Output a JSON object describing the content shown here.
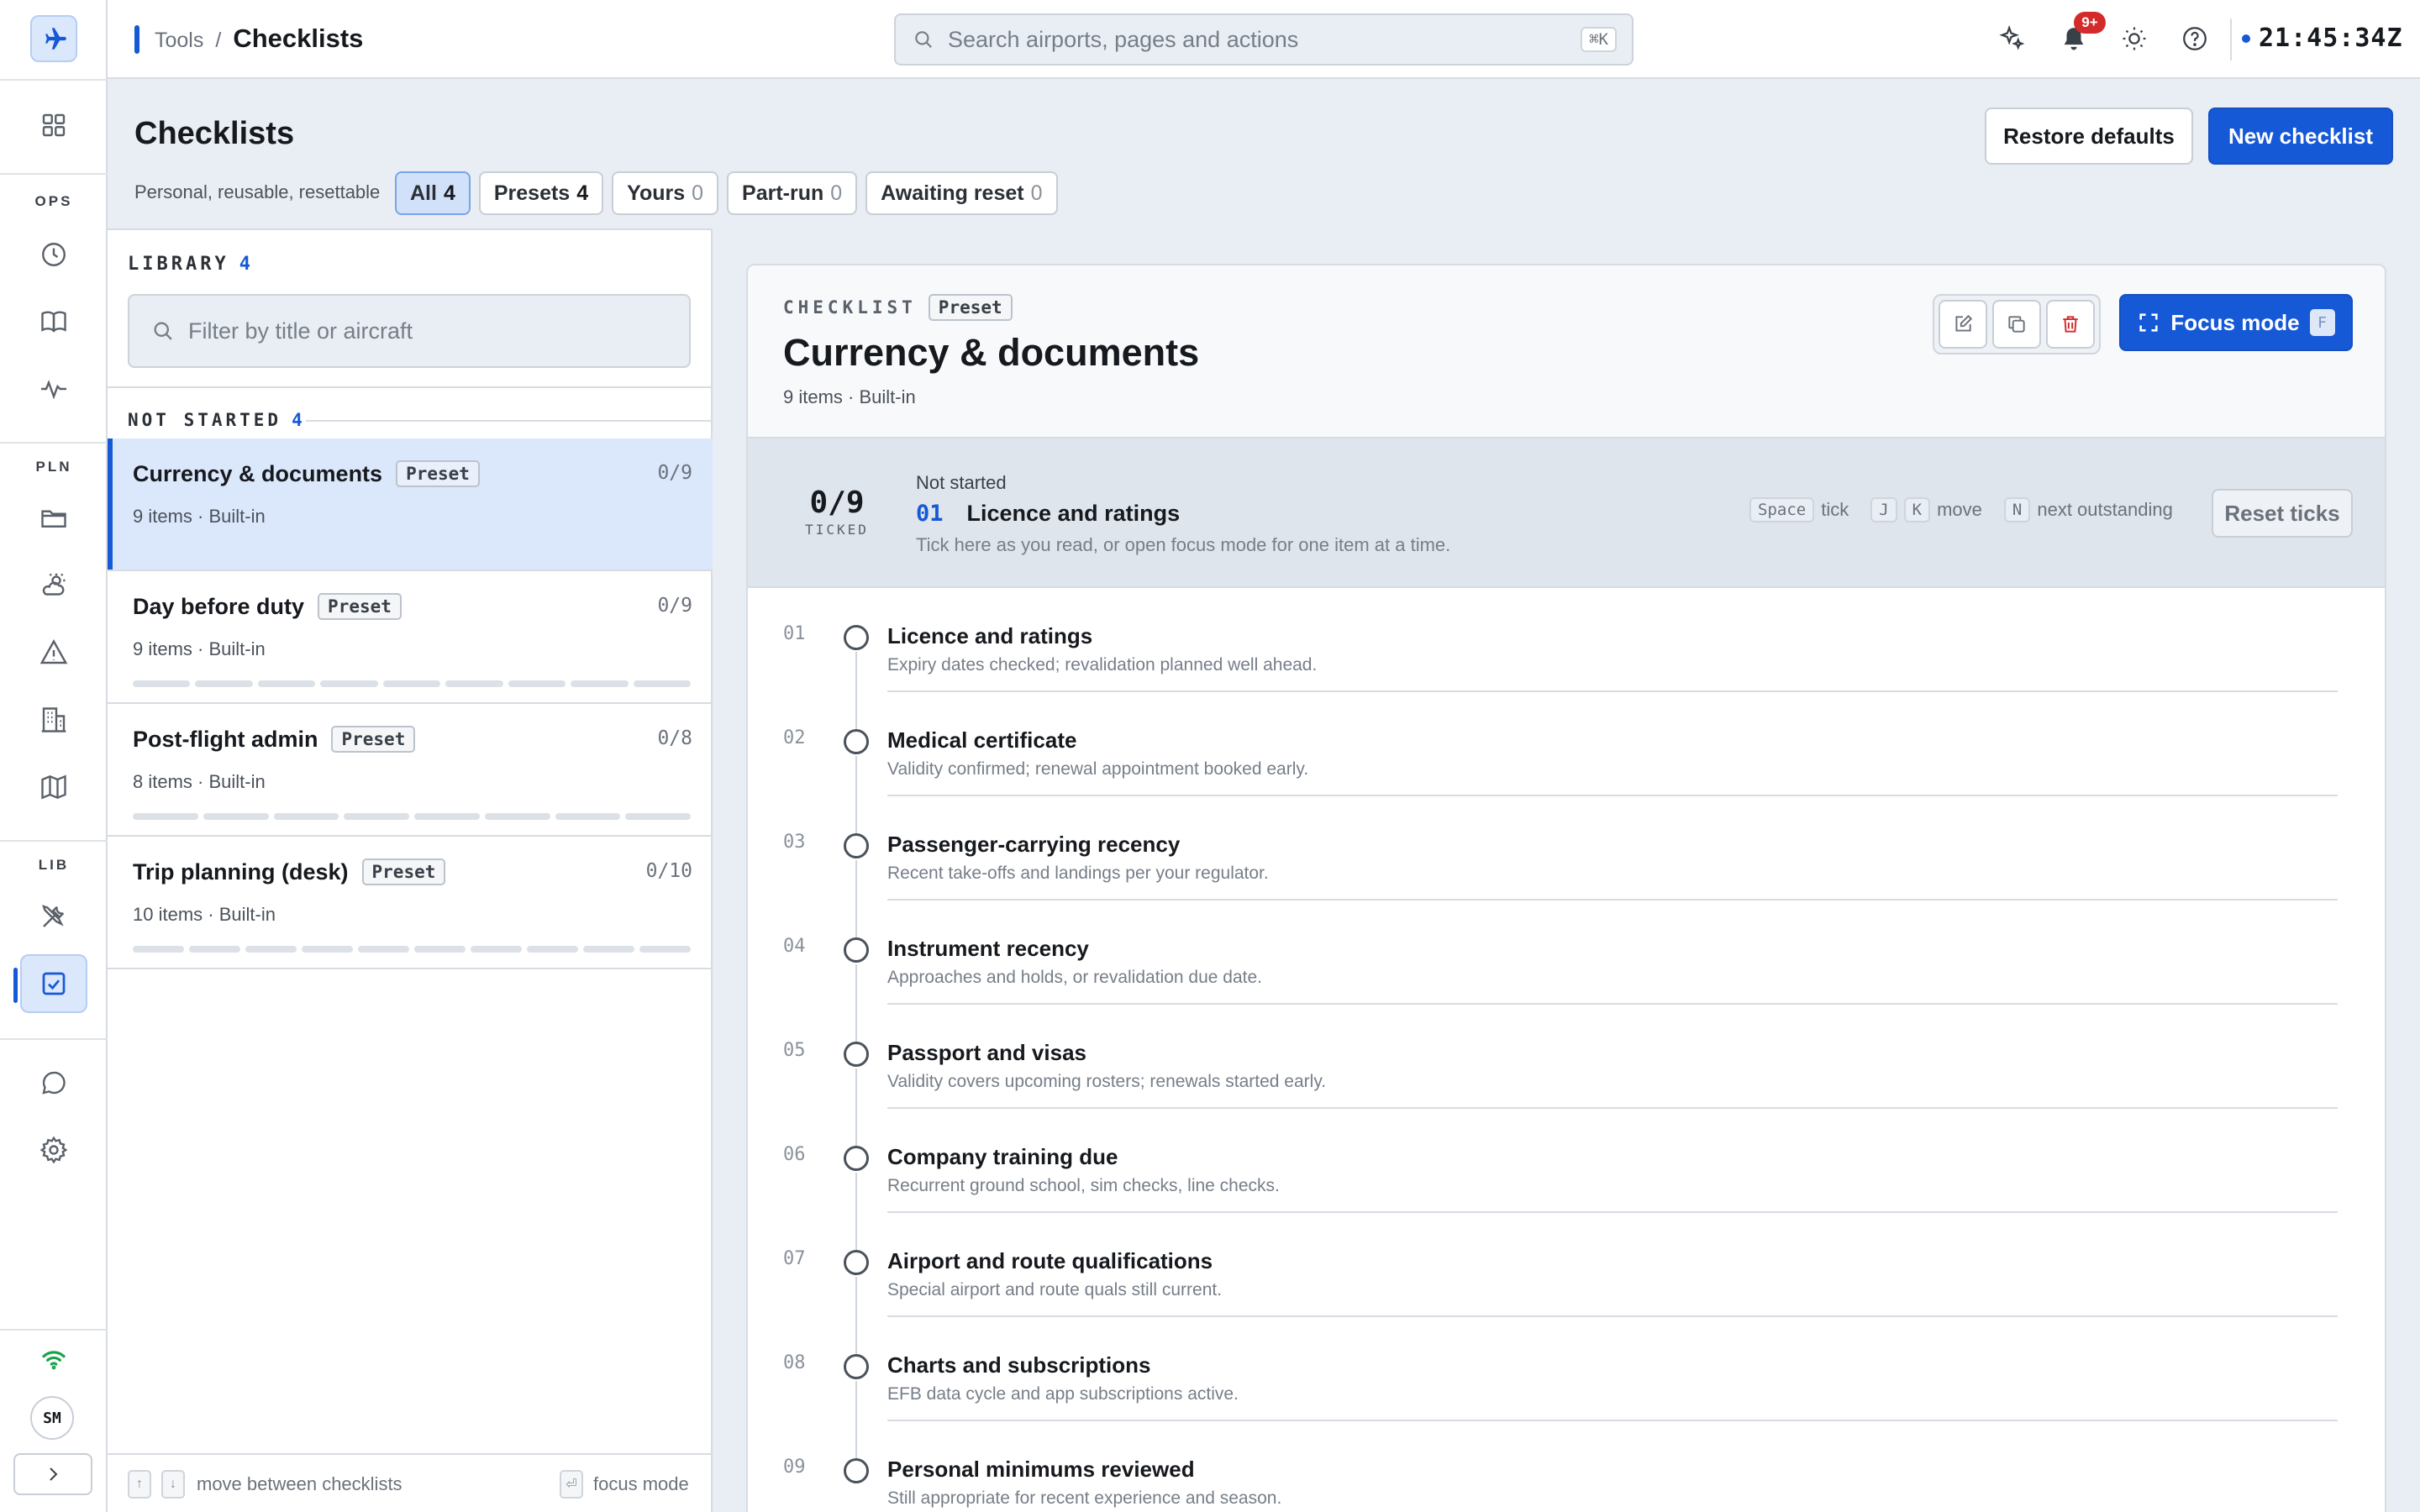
{
  "sidebar": {
    "sections": [
      "OPS",
      "PLN",
      "LIB"
    ],
    "user_initials": "SM"
  },
  "topbar": {
    "breadcrumb_parent": "Tools",
    "breadcrumb_sep": "/",
    "breadcrumb_current": "Checklists",
    "search_placeholder": "Search airports, pages and actions",
    "search_shortcut": "⌘K",
    "notification_badge": "9+",
    "clock": "21:45:34Z"
  },
  "page": {
    "title": "Checklists",
    "subtitle": "Personal, reusable, resettable",
    "tabs": [
      {
        "label": "All",
        "count": "4"
      },
      {
        "label": "Presets",
        "count": "4"
      },
      {
        "label": "Yours",
        "count": "0"
      },
      {
        "label": "Part-run",
        "count": "0"
      },
      {
        "label": "Awaiting reset",
        "count": "0"
      }
    ],
    "restore_label": "Restore defaults",
    "new_label": "New checklist"
  },
  "library": {
    "heading": "LIBRARY",
    "count": "4",
    "filter_placeholder": "Filter by title or aircraft",
    "group_label": "NOT STARTED",
    "group_count": "4",
    "items": [
      {
        "title": "Currency & documents",
        "tag": "Preset",
        "meta": "9 items · Built-in",
        "progress": "0/9",
        "segments": 9
      },
      {
        "title": "Day before duty",
        "tag": "Preset",
        "meta": "9 items · Built-in",
        "progress": "0/9",
        "segments": 9
      },
      {
        "title": "Post-flight admin",
        "tag": "Preset",
        "meta": "8 items · Built-in",
        "progress": "0/8",
        "segments": 8
      },
      {
        "title": "Trip planning (desk)",
        "tag": "Preset",
        "meta": "10 items · Built-in",
        "progress": "0/10",
        "segments": 10
      }
    ],
    "footer_move": "move between checklists",
    "footer_focus": "focus mode"
  },
  "detail": {
    "label": "CHECKLIST",
    "tag": "Preset",
    "title": "Currency & documents",
    "meta": "9 items · Built-in",
    "focus_label": "Focus mode",
    "focus_key": "F",
    "ticked_value": "0/9",
    "ticked_label": "TICKED",
    "status": "Not started",
    "current_no": "01",
    "current_title": "Licence and ratings",
    "hint": "Tick here as you read, or open focus mode for one item at a time.",
    "keys": {
      "space": "Space",
      "tick": "tick",
      "j": "J",
      "k": "K",
      "move": "move",
      "n": "N",
      "next": "next outstanding"
    },
    "reset_label": "Reset ticks",
    "items": [
      {
        "no": "01",
        "title": "Licence and ratings",
        "desc": "Expiry dates checked; revalidation planned well ahead."
      },
      {
        "no": "02",
        "title": "Medical certificate",
        "desc": "Validity confirmed; renewal appointment booked early."
      },
      {
        "no": "03",
        "title": "Passenger-carrying recency",
        "desc": "Recent take-offs and landings per your regulator."
      },
      {
        "no": "04",
        "title": "Instrument recency",
        "desc": "Approaches and holds, or revalidation due date."
      },
      {
        "no": "05",
        "title": "Passport and visas",
        "desc": "Validity covers upcoming rosters; renewals started early."
      },
      {
        "no": "06",
        "title": "Company training due",
        "desc": "Recurrent ground school, sim checks, line checks."
      },
      {
        "no": "07",
        "title": "Airport and route qualifications",
        "desc": "Special airport and route quals still current."
      },
      {
        "no": "08",
        "title": "Charts and subscriptions",
        "desc": "EFB data cycle and app subscriptions active."
      },
      {
        "no": "09",
        "title": "Personal minimums reviewed",
        "desc": "Still appropriate for recent experience and season."
      }
    ]
  },
  "colors": {
    "accent": "#1659d6",
    "selected_bg": "#dbe7fb",
    "badge": "#d42a2a",
    "delete": "#d42a2a",
    "online": "#18a34a"
  }
}
